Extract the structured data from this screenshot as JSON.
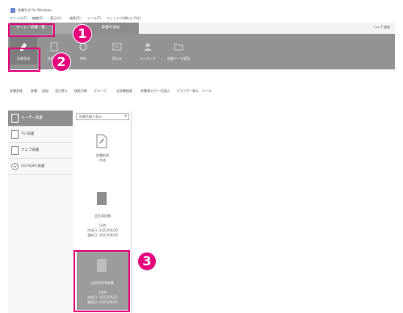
{
  "app": {
    "title": "辞書引き for Windows",
    "menu": [
      "ファイル(F)",
      "編集(E)",
      "表示(V)",
      "検索(S)",
      "ツール(T)",
      "ウィンドウ(W)",
      "ヘルプ(H)"
    ]
  },
  "tabs": {
    "main": "ホーム・辞書一覧",
    "second": "辞書の追加",
    "right_header": "ヘルプ  設定"
  },
  "ribbon": {
    "buttons": [
      {
        "label": "辞書登録",
        "icon": "pen-icon"
      },
      {
        "label": "辞書削除",
        "icon": "dictionary-icon"
      },
      {
        "label": "更新",
        "icon": "refresh-icon"
      },
      {
        "label": "読込み",
        "icon": "import-icon"
      },
      {
        "label": "ランキング",
        "icon": "person-icon"
      },
      {
        "label": "辞書データ管理",
        "icon": "folder-icon"
      }
    ]
  },
  "toolbar": {
    "items": [
      "辞書変換",
      "辞書",
      "追加",
      "並び替え",
      "検索対象",
      "グループ",
      "全辞書検索",
      "辞書表示データ読込",
      "ブラウザー表示",
      "ツール"
    ]
  },
  "sidebar": {
    "items": [
      {
        "label": "ユーザー辞書",
        "active": true
      },
      {
        "label": "TV 辞書",
        "active": false
      },
      {
        "label": "ウェブ辞書",
        "active": false
      },
      {
        "label": "CD-ROM 辞書",
        "active": false
      }
    ]
  },
  "filter": {
    "value": "辞書名順で表示"
  },
  "cards": {
    "new": {
      "line1": "辞書新規",
      "line2": "作成"
    },
    "dict1": {
      "title": "会社用辞書",
      "count": "10件",
      "created": "作成日: 2022/06/30",
      "updated": "更新日: 2022/06/30"
    },
    "dict2": {
      "title": "自宅用共有辞書",
      "count": "10件",
      "created": "作成日: 2022/06/12",
      "updated": "更新日: 2022/06/12"
    }
  },
  "callouts": [
    "1",
    "2",
    "3"
  ],
  "colors": {
    "accent": "#e6007e",
    "ribbon": "#939393",
    "selected": "#8e8e8e"
  }
}
